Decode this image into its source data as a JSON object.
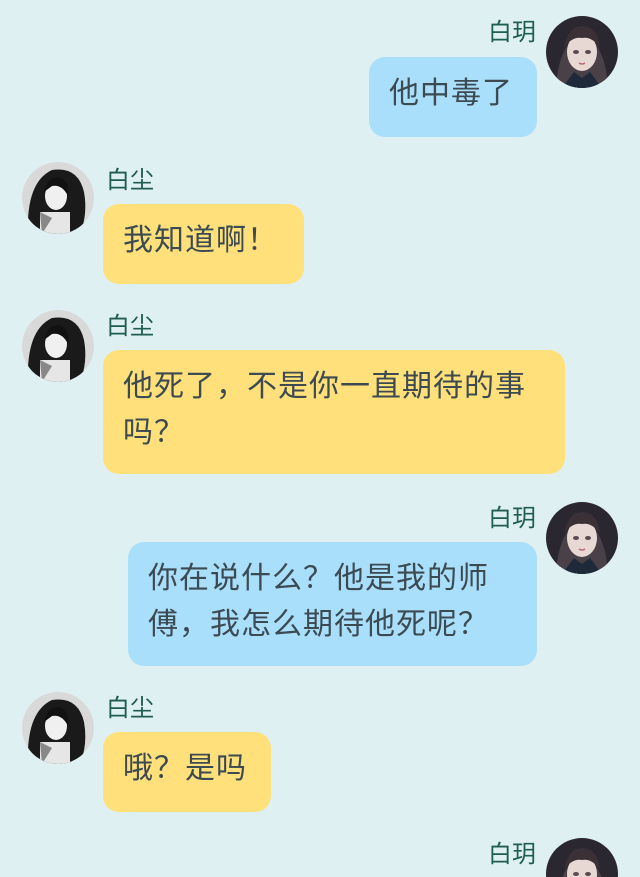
{
  "conversation": {
    "messages": [
      {
        "sender": "白玥",
        "side": "right",
        "text": "他中毒了"
      },
      {
        "sender": "白尘",
        "side": "left",
        "text": "我知道啊！"
      },
      {
        "sender": "白尘",
        "side": "left",
        "text": "他死了，不是你一直期待的事吗？"
      },
      {
        "sender": "白玥",
        "side": "right",
        "text": "你在说什么？他是我的师傅，我怎么期待他死呢？"
      },
      {
        "sender": "白尘",
        "side": "left",
        "text": "哦？是吗"
      },
      {
        "sender": "白玥",
        "side": "right",
        "text": ""
      }
    ]
  },
  "colors": {
    "background": "#dff0f3",
    "left_bubble": "#ffe07a",
    "right_bubble": "#aadffb",
    "sender_name": "#1f5d4d",
    "message_text": "#3c4a52"
  },
  "icons": {
    "left_avatar": "avatar-dark-hair-girl-icon",
    "right_avatar": "avatar-girl-uniform-icon"
  }
}
